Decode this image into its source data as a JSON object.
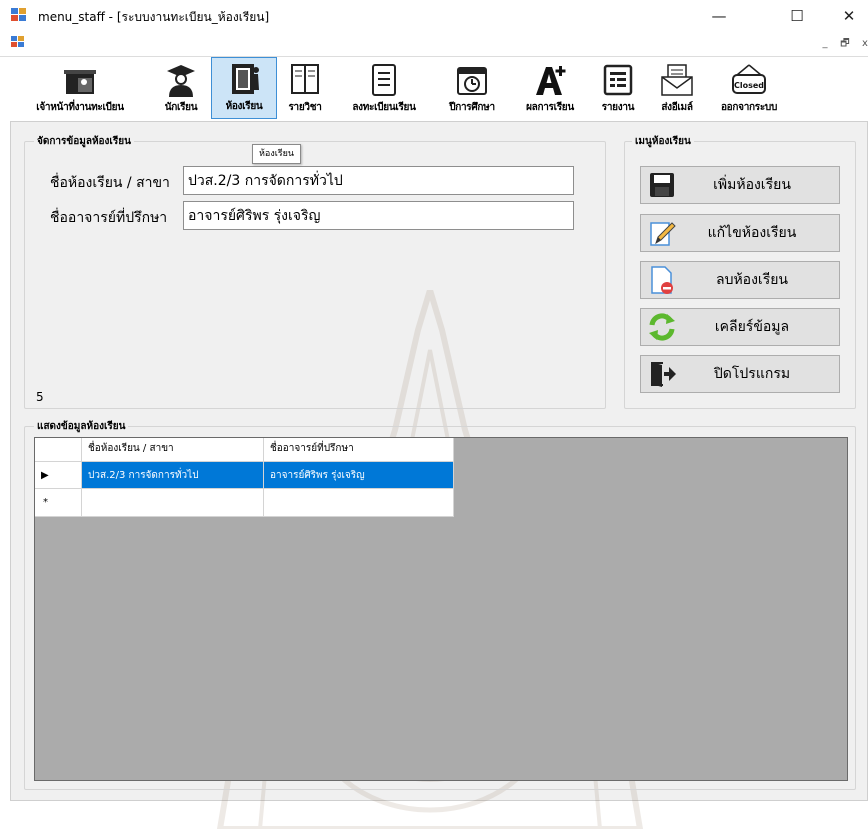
{
  "window": {
    "title": "menu_staff - [ระบบงานทะเบียน_ห้องเรียน]",
    "minimize": "—",
    "maximize": "☐",
    "close": "✕"
  },
  "mdi_controls": {
    "minimize": "_",
    "restore": "🗗",
    "close": "x"
  },
  "toolbar": {
    "items": [
      {
        "label": "เจ้าหน้าที่งานทะเบียน",
        "icon": "office-desk-icon"
      },
      {
        "label": "นักเรียน",
        "icon": "graduate-student-icon"
      },
      {
        "label": "ห้องเรียน",
        "icon": "classroom-door-icon"
      },
      {
        "label": "รายวิชา",
        "icon": "open-book-icon"
      },
      {
        "label": "ลงทะเบียนเรียน",
        "icon": "clipboard-list-icon"
      },
      {
        "label": "ปีการศึกษา",
        "icon": "calendar-clock-icon"
      },
      {
        "label": "ผลการเรียน",
        "icon": "grade-a-plus-icon"
      },
      {
        "label": "รายงาน",
        "icon": "report-icon"
      },
      {
        "label": "ส่งอีเมล์",
        "icon": "mail-letter-icon"
      },
      {
        "label": "ออกจากระบบ",
        "icon": "closed-sign-icon"
      }
    ],
    "active_index": 2,
    "tooltip": "ห้องเรียน"
  },
  "manage_group": {
    "title": "จัดการข้อมูลห้องเรียน",
    "room_label": "ชื่อห้องเรียน / สาขา",
    "room_value": "ปวส.2/3 การจัดการทั่วไป",
    "teacher_label": "ชื่ออาจารย์ที่ปรึกษา",
    "teacher_value": "อาจารย์ศิริพร รุ่งเจริญ",
    "count": "5"
  },
  "menu_group": {
    "title": "เมนูห้องเรียน",
    "buttons": [
      {
        "label": "เพิ่มห้องเรียน",
        "icon": "floppy-save-icon"
      },
      {
        "label": "แก้ไขห้องเรียน",
        "icon": "edit-pencil-icon"
      },
      {
        "label": "ลบห้องเรียน",
        "icon": "delete-document-icon"
      },
      {
        "label": "เคลียร์ข้อมูล",
        "icon": "refresh-arrows-icon"
      },
      {
        "label": "ปิดโปรแกรม",
        "icon": "exit-door-icon"
      }
    ]
  },
  "grid_group": {
    "title": "แสดงข้อมูลห้องเรียน",
    "columns": [
      "ชื่อห้องเรียน / สาขา",
      "ชื่ออาจารย์ที่ปรึกษา"
    ],
    "rows": [
      {
        "indicator": "▶",
        "cells": [
          "ปวส.2/3 การจัดการทั่วไป",
          "อาจารย์ศิริพร รุ่งเจริญ"
        ]
      }
    ],
    "new_row_indicator": "*"
  },
  "colors": {
    "selection": "#0078d7",
    "active_toolbar_bg": "#cce4f7",
    "form_bg": "#f0f0f0",
    "grid_bg": "#ababab"
  }
}
